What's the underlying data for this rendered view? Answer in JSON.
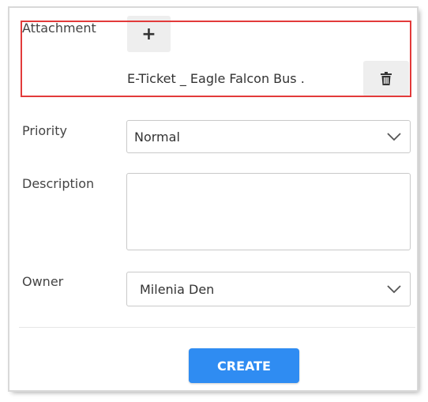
{
  "attachment": {
    "label": "Attachment",
    "add_symbol": "+",
    "file_name": "E-Ticket _ Eagle Falcon Bus ."
  },
  "priority": {
    "label": "Priority",
    "value": "Normal"
  },
  "description": {
    "label": "Description",
    "value": ""
  },
  "owner": {
    "label": "Owner",
    "value": "Milenia Den"
  },
  "actions": {
    "create_label": "CREATE"
  },
  "colors": {
    "accent": "#2f8cf2",
    "highlight": "#e23a3a"
  },
  "icons": {
    "add": "plus-icon",
    "delete": "trash-icon",
    "dropdown": "chevron-down-icon"
  }
}
